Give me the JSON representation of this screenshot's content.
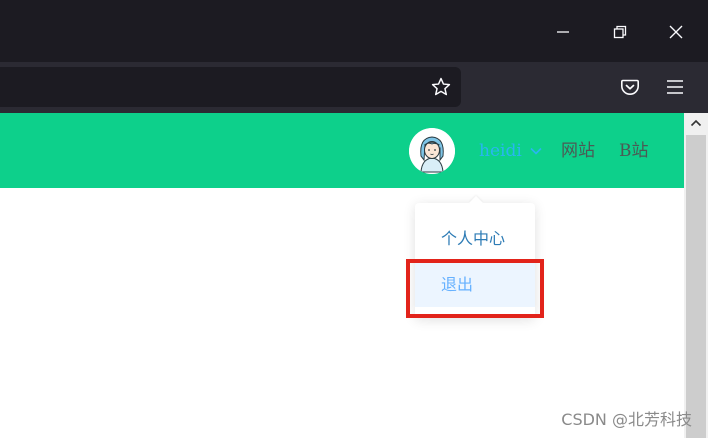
{
  "browser": {
    "window_controls": {
      "minimize": "minimize-icon",
      "restore": "restore-icon",
      "close": "close-icon"
    },
    "toolbar": {
      "bookmark": "star-icon",
      "pocket": "pocket-icon",
      "menu": "hamburger-icon"
    }
  },
  "header": {
    "user_name": "heidi",
    "links": [
      "网站",
      "B站"
    ]
  },
  "dropdown": {
    "items": [
      "个人中心",
      "退出"
    ],
    "hovered": "退出"
  },
  "watermark": "CSDN @北芳科技",
  "colors": {
    "header_bg": "#0dd08b",
    "user_name": "#29b6f0",
    "highlight_border": "#e2231a",
    "menu_hover_bg": "#ecf5ff",
    "menu_hover_text": "#66b1ff"
  }
}
